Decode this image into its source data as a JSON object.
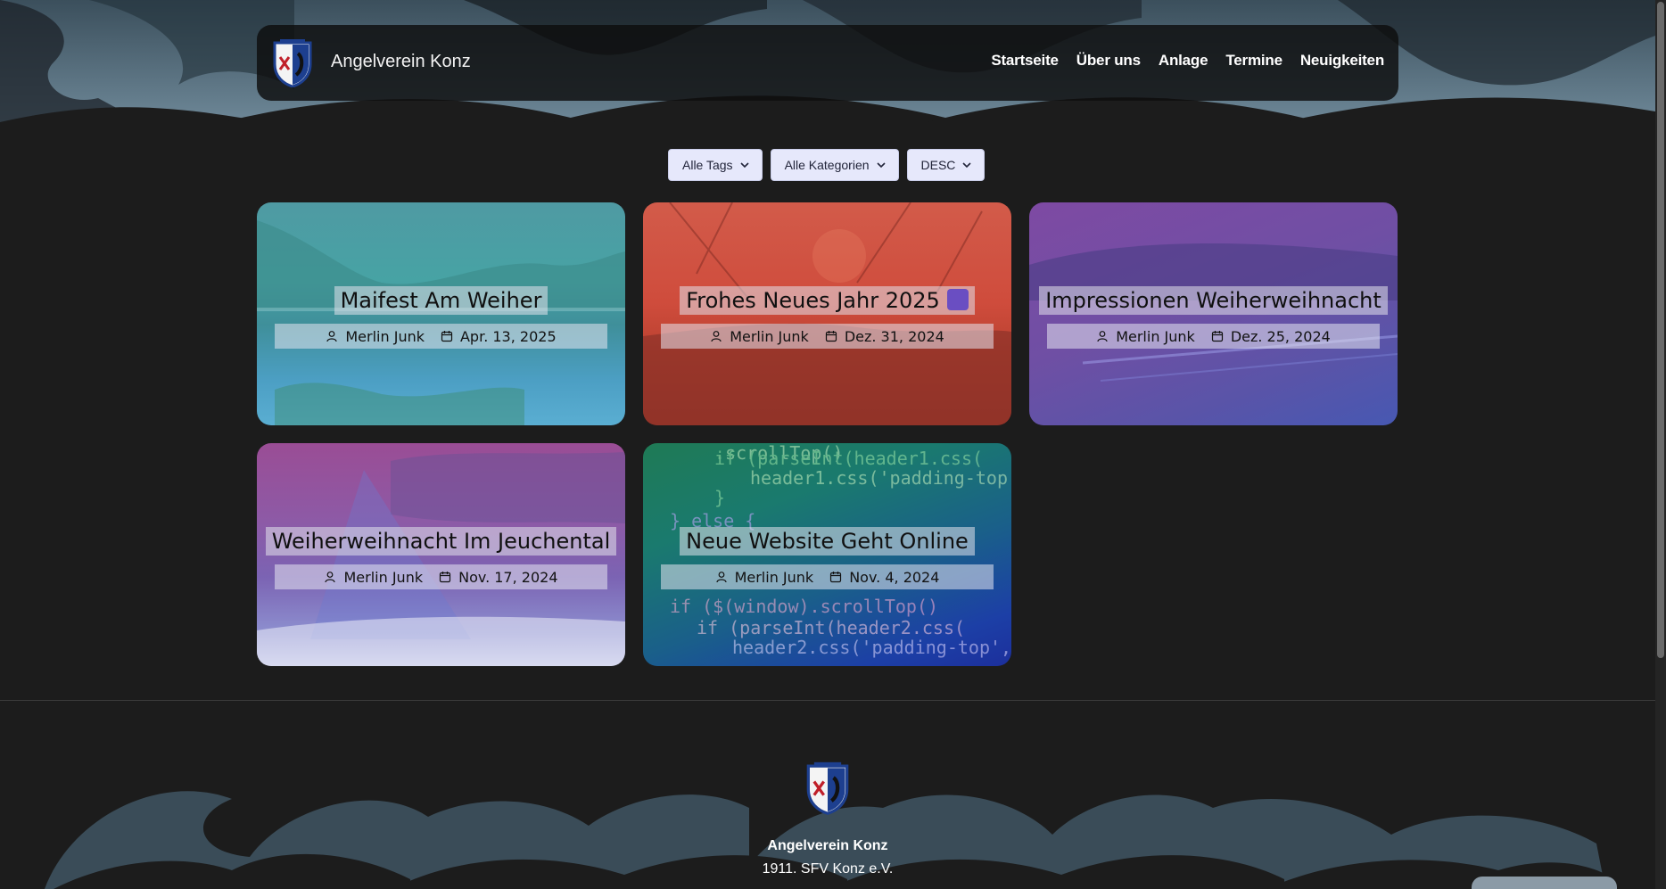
{
  "brand": {
    "name": "Angelverein Konz"
  },
  "nav": {
    "items": [
      "Startseite",
      "Über uns",
      "Anlage",
      "Termine",
      "Neuigkeiten"
    ]
  },
  "filters": {
    "tags": "Alle Tags",
    "categories": "Alle Kategorien",
    "order": "DESC"
  },
  "posts": [
    {
      "title": "Maifest Am Weiher",
      "author": "Merlin Junk",
      "date": "Apr. 13, 2025"
    },
    {
      "title": "Frohes Neues Jahr 2025",
      "author": "Merlin Junk",
      "date": "Dez. 31, 2024"
    },
    {
      "title": "Impressionen Weiherweihnacht",
      "author": "Merlin Junk",
      "date": "Dez. 25, 2024"
    },
    {
      "title": "Weiherweihnacht Im Jeuchental",
      "author": "Merlin Junk",
      "date": "Nov. 17, 2024"
    },
    {
      "title": "Neue Website Geht Online",
      "author": "Merlin Junk",
      "date": "Nov. 4, 2024"
    }
  ],
  "footer": {
    "name": "Angelverein Konz",
    "subtitle": "1911. SFV Konz e.V."
  },
  "icons": {
    "logo": "club-crest-icon",
    "author": "user-icon",
    "date": "calendar-icon",
    "dropdown": "chevron-down-icon",
    "fireworks": "fireworks-emoji-icon"
  },
  "colors": {
    "page_bg": "#1c1c1c",
    "navbar_bg": "#0e0e0e",
    "filter_bg": "#e6e8fb"
  }
}
